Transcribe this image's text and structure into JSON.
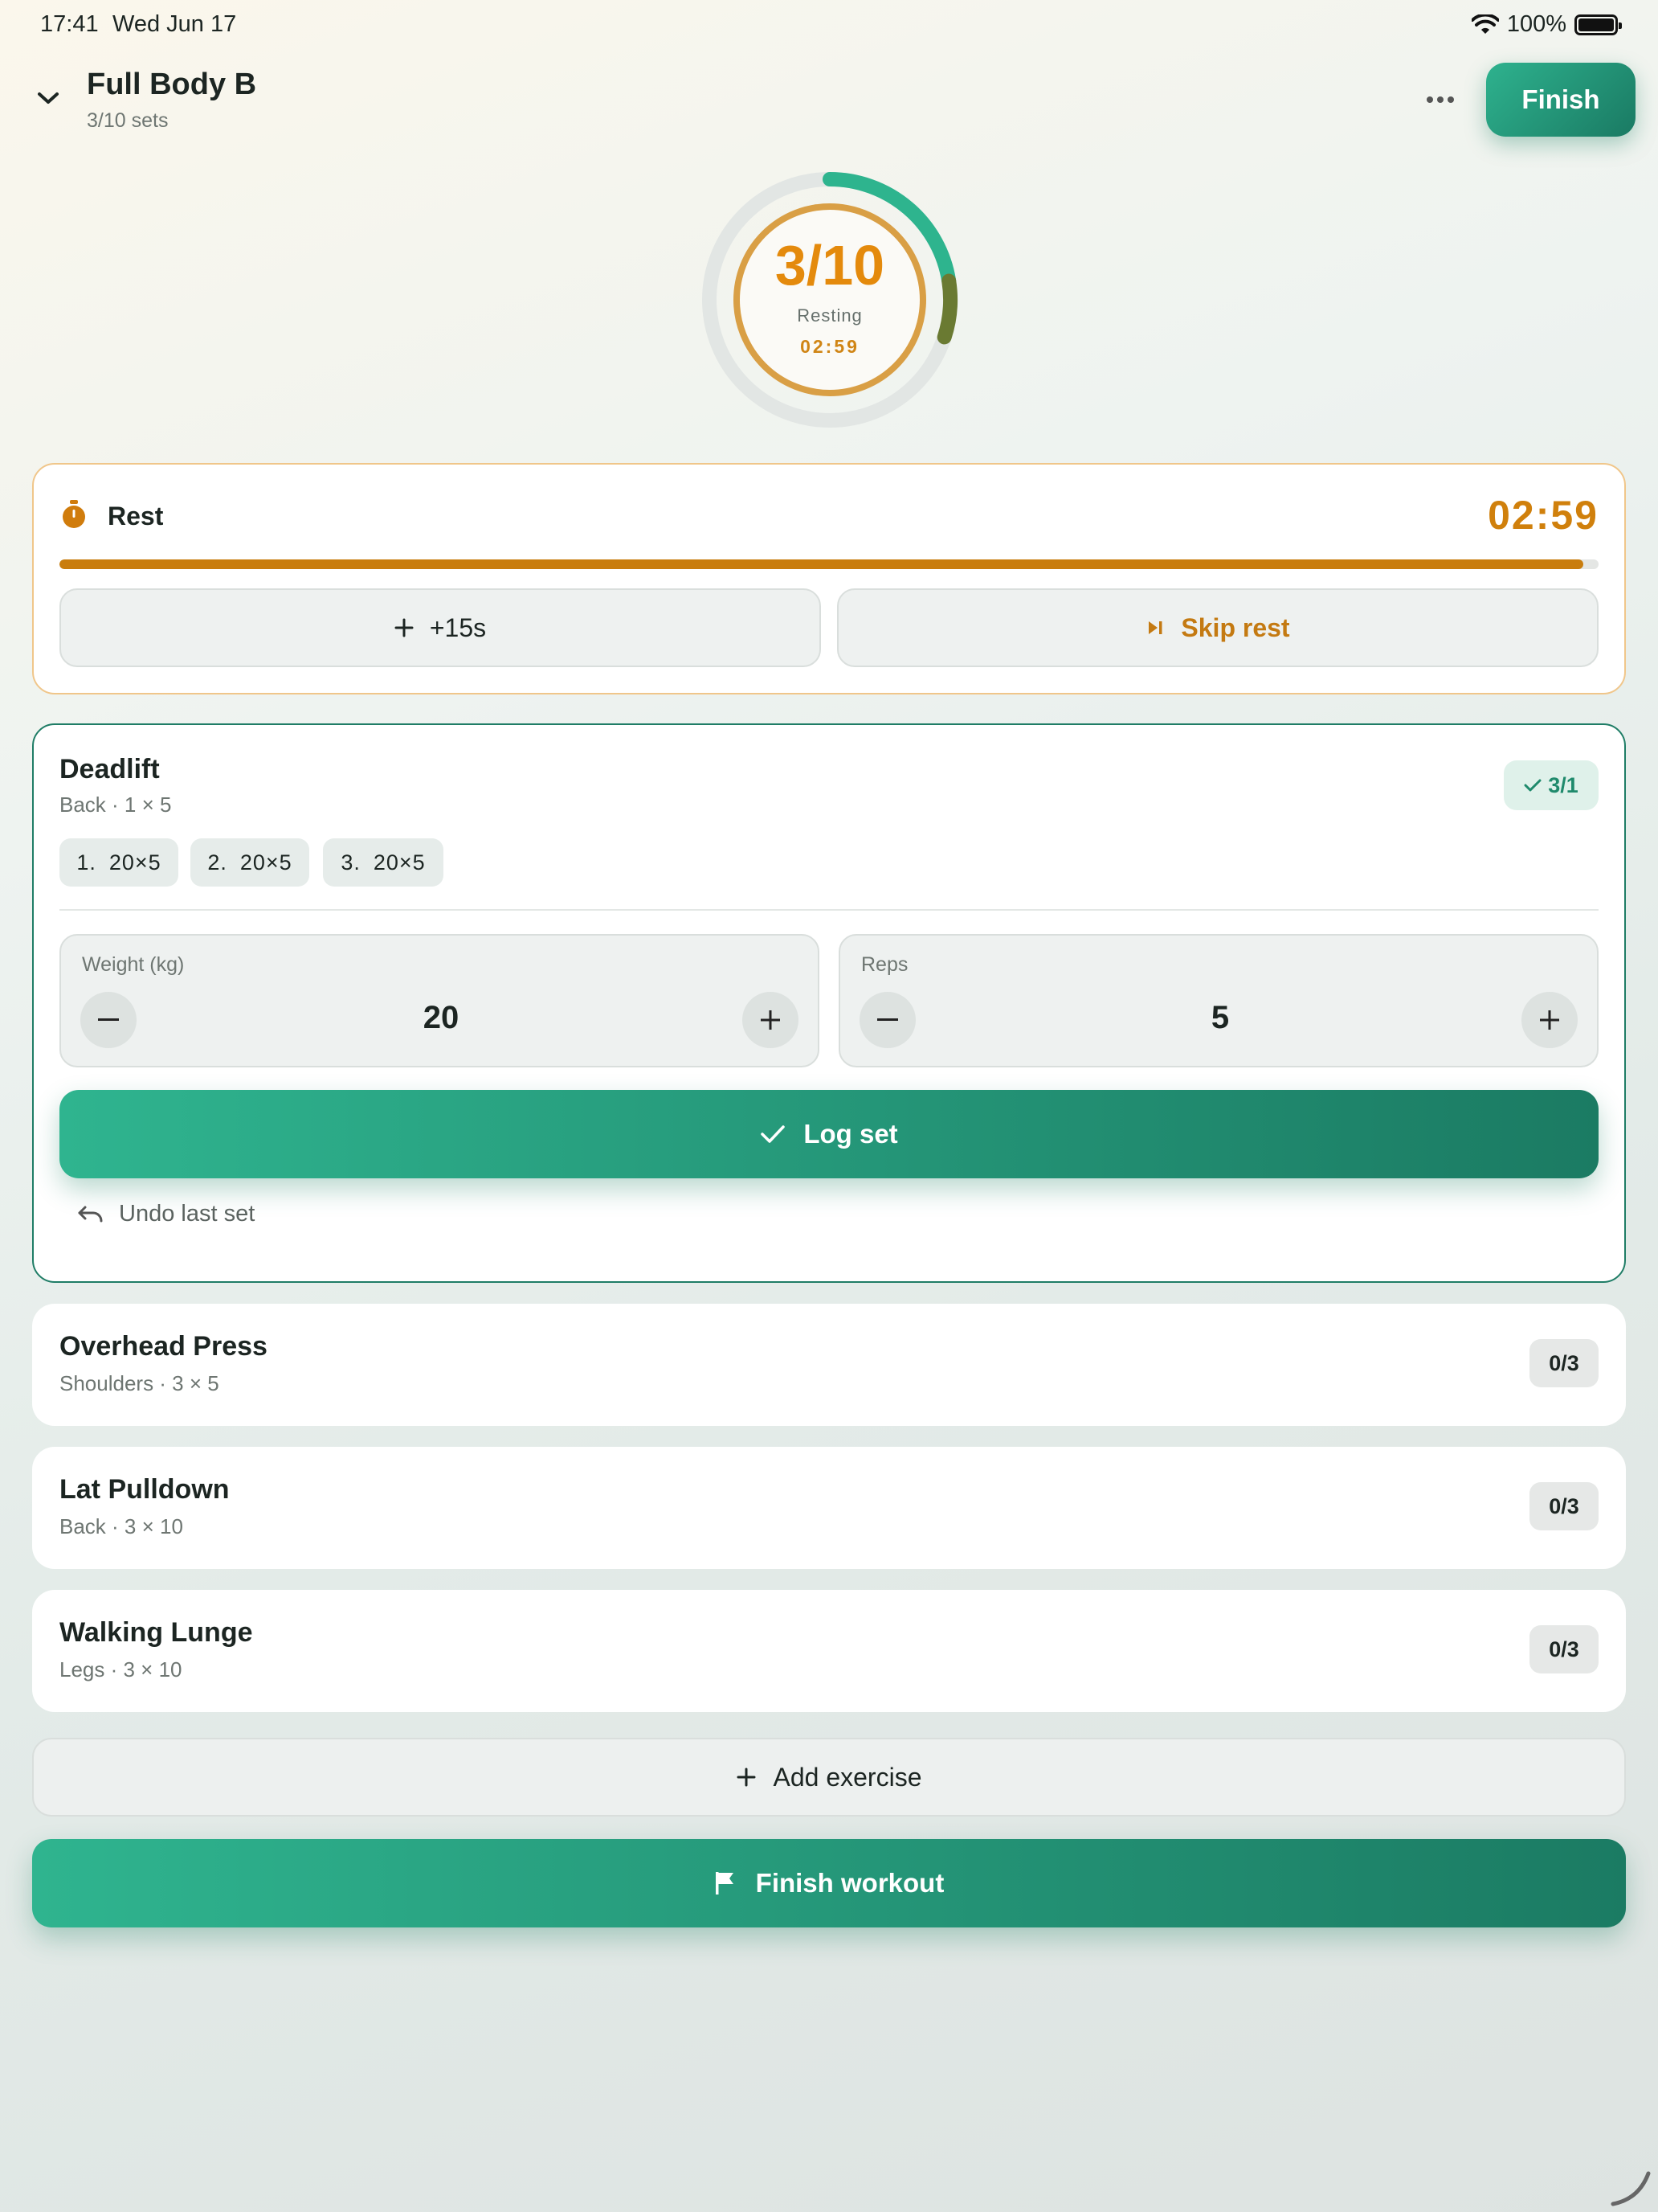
{
  "status_bar": {
    "time": "17:41",
    "date": "Wed Jun 17",
    "battery": "100%"
  },
  "header": {
    "title": "Full Body B",
    "subtitle": "3/10 sets",
    "finish_label": "Finish"
  },
  "progress": {
    "count": "3/10",
    "status": "Resting",
    "timer": "02:59",
    "completed_fraction": 0.3
  },
  "rest": {
    "label": "Rest",
    "timer": "02:59",
    "progress_fraction": 0.99,
    "add_label": "+15s",
    "skip_label": "Skip rest"
  },
  "current_exercise": {
    "name": "Deadlift",
    "meta": "Back · 1 × 5",
    "badge": "3/1",
    "logged_sets": [
      {
        "num": "1.",
        "value": "20×5"
      },
      {
        "num": "2.",
        "value": "20×5"
      },
      {
        "num": "3.",
        "value": "20×5"
      }
    ],
    "weight": {
      "label": "Weight (kg)",
      "value": "20"
    },
    "reps": {
      "label": "Reps",
      "value": "5"
    },
    "log_label": "Log set",
    "undo_label": "Undo last set"
  },
  "exercises": [
    {
      "name": "Overhead Press",
      "meta": "Shoulders · 3 × 5",
      "badge": "0/3"
    },
    {
      "name": "Lat Pulldown",
      "meta": "Back · 3 × 10",
      "badge": "0/3"
    },
    {
      "name": "Walking Lunge",
      "meta": "Legs · 3 × 10",
      "badge": "0/3"
    }
  ],
  "footer": {
    "add_exercise_label": "Add exercise",
    "finish_workout_label": "Finish workout"
  },
  "colors": {
    "accent": "#2eb28e",
    "accent_dark": "#1a7a63",
    "rest_orange": "#c97d0e",
    "timer_orange": "#e48a0c"
  },
  "icons": [
    "chevron-down-icon",
    "more-icon",
    "stopwatch-icon",
    "plus-icon",
    "skip-icon",
    "check-icon",
    "minus-icon",
    "undo-icon",
    "flag-icon",
    "wifi-icon",
    "battery-icon"
  ]
}
